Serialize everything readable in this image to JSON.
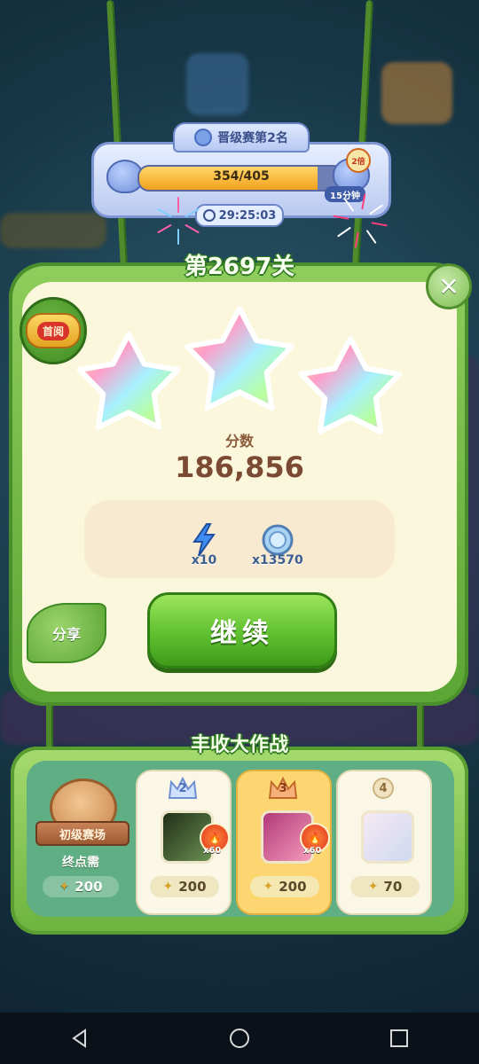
{
  "promotion": {
    "title": "晋级赛第2名",
    "progress_text": "354/405",
    "progress_fraction": 0.874,
    "timer": "29:25:03",
    "boost_badge": "2倍",
    "boost_duration": "15分钟"
  },
  "level": {
    "title": "第2697关",
    "first_clear_badge": "首阅",
    "stars_earned": 3,
    "score_label": "分数",
    "score_value": "186,856"
  },
  "rewards": [
    {
      "icon": "lightning-icon",
      "count": "x10"
    },
    {
      "icon": "coin-icon",
      "count": "x13570"
    }
  ],
  "actions": {
    "share_label": "分享",
    "continue_label": "继续",
    "close_icon": "close-icon"
  },
  "event": {
    "title": "丰收大作战",
    "beginner": {
      "label": "初级赛场",
      "requirement": "终点需",
      "cost": "200"
    },
    "stages": [
      {
        "rank": "2",
        "multiplier": "x60",
        "cost": "200"
      },
      {
        "rank": "3",
        "multiplier": "x60",
        "cost": "200"
      },
      {
        "rank": "4",
        "multiplier": "",
        "cost": "70"
      }
    ]
  },
  "colors": {
    "panel_green": "#5aa534",
    "panel_cream": "#fbf7dd",
    "button_green": "#5fc02f",
    "score_brown": "#7a4a32"
  }
}
